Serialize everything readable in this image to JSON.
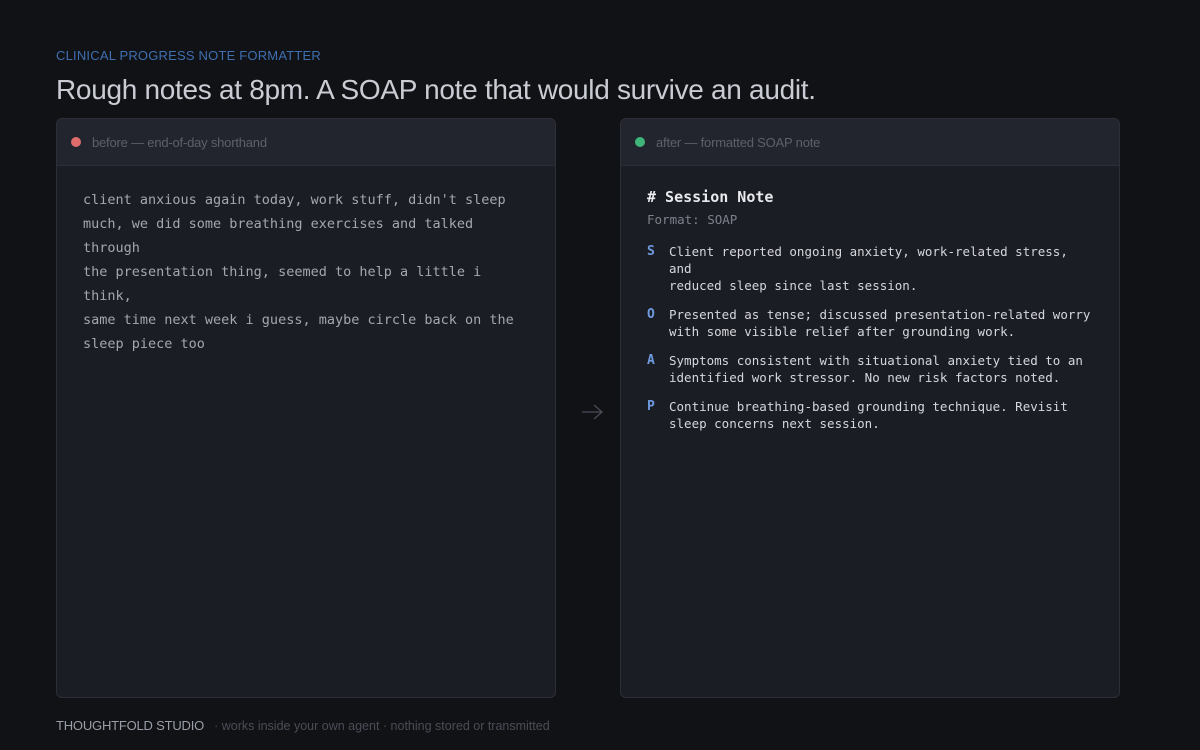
{
  "header": {
    "eyebrow": "CLINICAL PROGRESS NOTE FORMATTER",
    "headline": "Rough notes at 8pm. A SOAP note that would survive an audit."
  },
  "before_panel": {
    "label": "before — end-of-day shorthand",
    "dot_color": "#e06c6c",
    "text": "client anxious again today, work stuff, didn't sleep\nmuch, we did some breathing exercises and talked through\nthe presentation thing, seemed to help a little i think,\nsame time next week i guess, maybe circle back on the\nsleep piece too"
  },
  "after_panel": {
    "label": "after — formatted SOAP note",
    "dot_color": "#3fb57a",
    "title": "# Session Note",
    "format": "Format: SOAP",
    "sections": [
      {
        "letter": "S",
        "text": "Client reported ongoing anxiety, work-related stress, and\nreduced sleep since last session."
      },
      {
        "letter": "O",
        "text": "Presented as tense; discussed presentation-related worry\nwith some visible relief after grounding work."
      },
      {
        "letter": "A",
        "text": "Symptoms consistent with situational anxiety tied to an\nidentified work stressor. No new risk factors noted."
      },
      {
        "letter": "P",
        "text": "Continue breathing-based grounding technique. Revisit\nsleep concerns next session."
      }
    ]
  },
  "arrow_icon": "arrow-right-icon",
  "footer": {
    "brand": "THOUGHTFOLD STUDIO",
    "tagline": "· works inside your own agent · nothing stored or transmitted"
  },
  "colors": {
    "background": "#111216",
    "panel": "#1b1d24",
    "accent": "#6f9ae0",
    "eyebrow": "#3f6fb0"
  }
}
